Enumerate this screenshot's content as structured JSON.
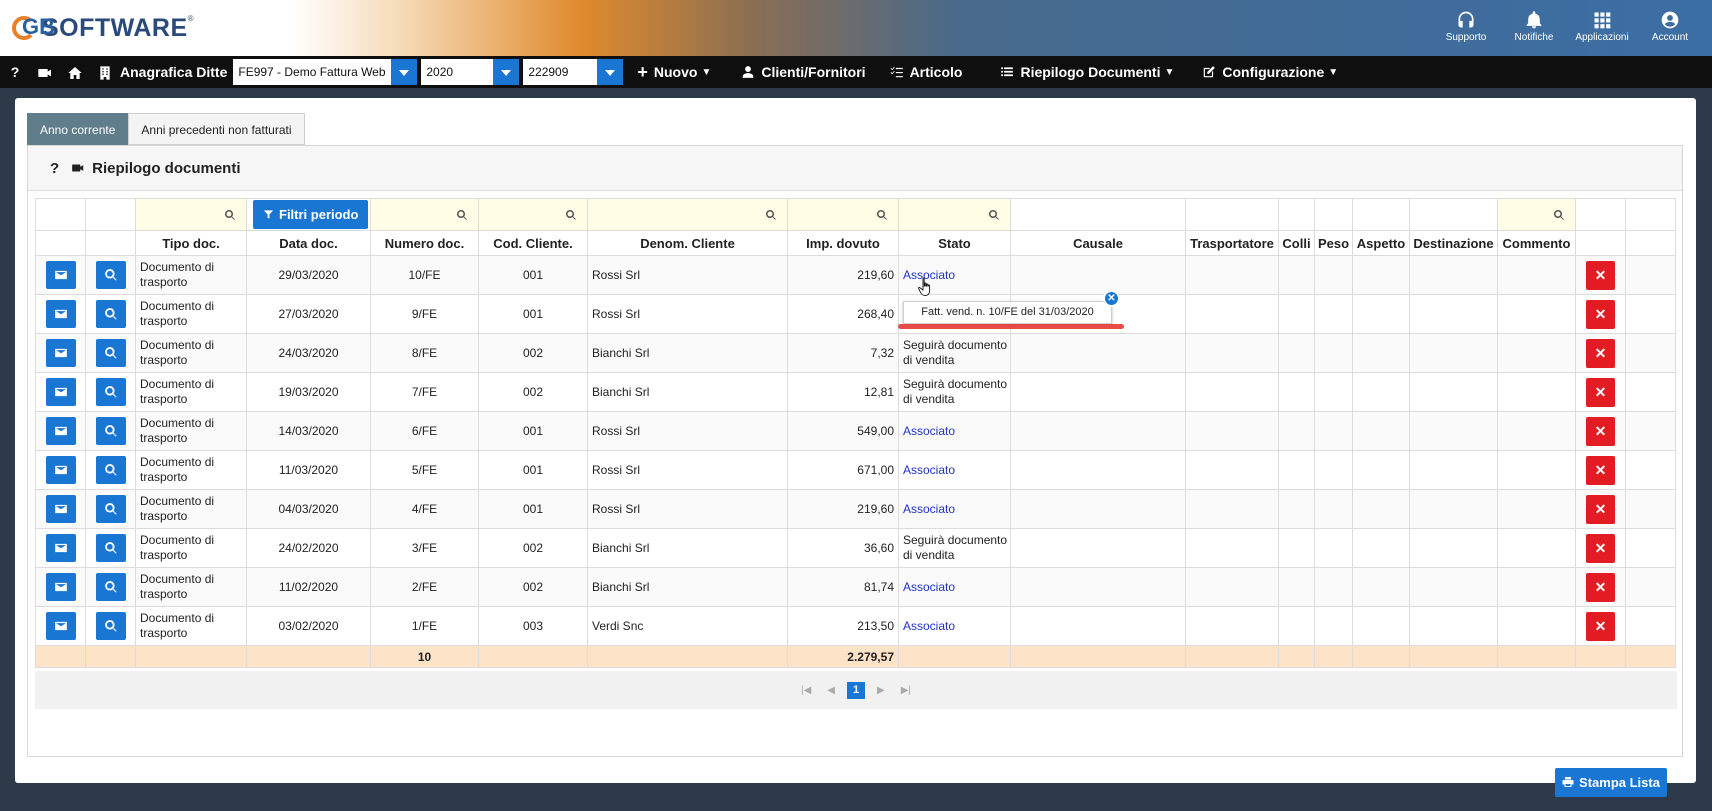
{
  "brand": {
    "logo_letters": "GB",
    "logo_text": "SOFTWARE",
    "logo_reg": "®"
  },
  "header_actions": [
    {
      "icon": "headset-icon",
      "label": "Supporto"
    },
    {
      "icon": "bell-icon",
      "label": "Notifiche"
    },
    {
      "icon": "grid-icon",
      "label": "Applicazioni"
    },
    {
      "icon": "account-icon",
      "label": "Account"
    }
  ],
  "nav": {
    "help": "?",
    "anagrafica_label": "Anagrafica Ditte",
    "ditta_value": "FE997 - Demo Fattura Web",
    "year_value": "2020",
    "code_value": "222909",
    "menus": {
      "nuovo": "Nuovo",
      "clienti": "Clienti/Fornitori",
      "articolo": "Articolo",
      "riepilogo": "Riepilogo Documenti",
      "configurazione": "Configurazione"
    }
  },
  "tabs": [
    {
      "label": "Anno corrente",
      "active": true
    },
    {
      "label": "Anni precedenti non fatturati",
      "active": false
    }
  ],
  "panel": {
    "help": "?",
    "title": "Riepilogo documenti"
  },
  "filters": {
    "period_button": "Filtri periodo"
  },
  "columns": [
    "Tipo doc.",
    "Data doc.",
    "Numero doc.",
    "Cod. Cliente.",
    "Denom. Cliente",
    "Imp. dovuto",
    "Stato",
    "Causale",
    "Trasportatore",
    "Colli",
    "Peso",
    "Aspetto",
    "Destinazione",
    "Commento"
  ],
  "rows": [
    {
      "tipo": "Documento di trasporto",
      "data": "29/03/2020",
      "numero": "10/FE",
      "cod": "001",
      "denom": "Rossi Srl",
      "imp": "219,60",
      "stato": "Associato",
      "link": true
    },
    {
      "tipo": "Documento di trasporto",
      "data": "27/03/2020",
      "numero": "9/FE",
      "cod": "001",
      "denom": "Rossi Srl",
      "imp": "268,40",
      "stato": "",
      "link": false
    },
    {
      "tipo": "Documento di trasporto",
      "data": "24/03/2020",
      "numero": "8/FE",
      "cod": "002",
      "denom": "Bianchi Srl",
      "imp": "7,32",
      "stato": "Seguirà documento di vendita",
      "link": false
    },
    {
      "tipo": "Documento di trasporto",
      "data": "19/03/2020",
      "numero": "7/FE",
      "cod": "002",
      "denom": "Bianchi Srl",
      "imp": "12,81",
      "stato": "Seguirà documento di vendita",
      "link": false
    },
    {
      "tipo": "Documento di trasporto",
      "data": "14/03/2020",
      "numero": "6/FE",
      "cod": "001",
      "denom": "Rossi Srl",
      "imp": "549,00",
      "stato": "Associato",
      "link": true
    },
    {
      "tipo": "Documento di trasporto",
      "data": "11/03/2020",
      "numero": "5/FE",
      "cod": "001",
      "denom": "Rossi Srl",
      "imp": "671,00",
      "stato": "Associato",
      "link": true
    },
    {
      "tipo": "Documento di trasporto",
      "data": "04/03/2020",
      "numero": "4/FE",
      "cod": "001",
      "denom": "Rossi Srl",
      "imp": "219,60",
      "stato": "Associato",
      "link": true
    },
    {
      "tipo": "Documento di trasporto",
      "data": "24/02/2020",
      "numero": "3/FE",
      "cod": "002",
      "denom": "Bianchi Srl",
      "imp": "36,60",
      "stato": "Seguirà documento di vendita",
      "link": false
    },
    {
      "tipo": "Documento di trasporto",
      "data": "11/02/2020",
      "numero": "2/FE",
      "cod": "002",
      "denom": "Bianchi Srl",
      "imp": "81,74",
      "stato": "Associato",
      "link": true
    },
    {
      "tipo": "Documento di trasporto",
      "data": "03/02/2020",
      "numero": "1/FE",
      "cod": "003",
      "denom": "Verdi Snc",
      "imp": "213,50",
      "stato": "Associato",
      "link": true
    }
  ],
  "totals": {
    "count": "10",
    "amount": "2.279,57"
  },
  "pager": {
    "current": "1"
  },
  "print_button": "Stampa Lista",
  "tooltip": {
    "text": "Fatt. vend. n. 10/FE del 31/03/2020"
  },
  "colors": {
    "primary": "#1976d2",
    "danger": "#e31b23",
    "tab_active": "#607d8b",
    "total_row": "#fde3c8",
    "filter_cell": "#fffde6",
    "link": "#2133c4"
  }
}
